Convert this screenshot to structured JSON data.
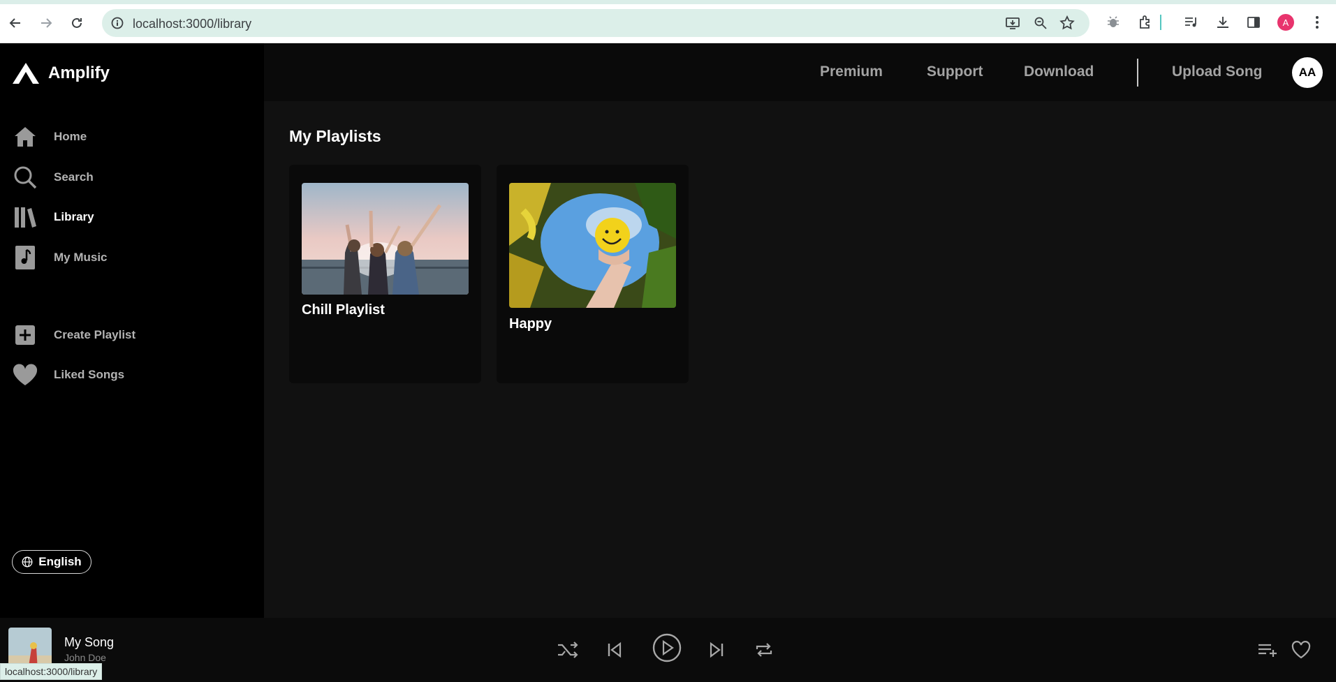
{
  "browser": {
    "url": "localhost:3000/library",
    "profile_initial": "A",
    "status_url": "localhost:3000/library"
  },
  "app": {
    "brand": "Amplify",
    "nav": [
      {
        "label": "Home",
        "icon": "home-icon"
      },
      {
        "label": "Search",
        "icon": "search-icon"
      },
      {
        "label": "Library",
        "icon": "library-icon",
        "active": true
      },
      {
        "label": "My Music",
        "icon": "music-note-icon"
      }
    ],
    "secondary_nav": [
      {
        "label": "Create Playlist",
        "icon": "plus-icon"
      },
      {
        "label": "Liked Songs",
        "icon": "heart-icon"
      }
    ],
    "language": "English"
  },
  "topbar": {
    "links": [
      "Premium",
      "Support",
      "Download"
    ],
    "upload": "Upload Song",
    "avatar": "AA"
  },
  "main": {
    "title": "My Playlists",
    "playlists": [
      {
        "name": "Chill Playlist"
      },
      {
        "name": "Happy"
      }
    ]
  },
  "player": {
    "song": "My Song",
    "artist": "John Doe"
  },
  "colors": {
    "sidebar_bg": "#000000",
    "main_bg": "#111111",
    "card_bg": "#0a0a0a",
    "muted_text": "#b3b3b3"
  }
}
